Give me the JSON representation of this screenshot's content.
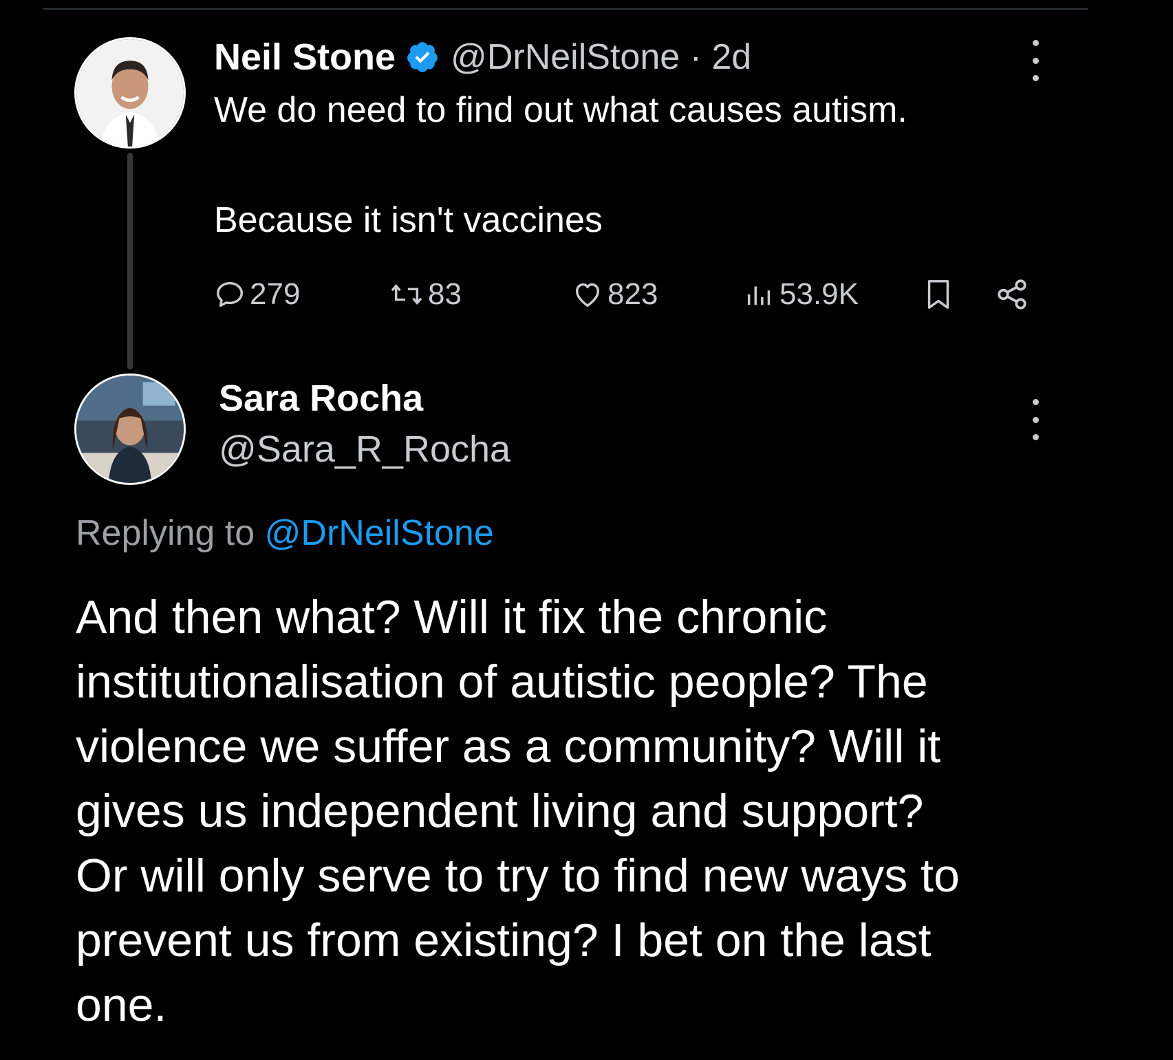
{
  "colors": {
    "background": "#000000",
    "text_primary": "#ffffff",
    "text_secondary": "#c8cbcf",
    "link": "#1d9bf0",
    "verified": "#1d9bf0",
    "divider": "#2f3336"
  },
  "original_tweet": {
    "author_name": "Neil Stone",
    "verified": true,
    "handle_time": "@DrNeilStone · 2d",
    "text_line1": "We do need to find out what causes autism.",
    "text_line2": "Because it isn't vaccines",
    "actions": {
      "replies": "279",
      "retweets": "83",
      "likes": "823",
      "views": "53.9K"
    },
    "icons": [
      "verified-icon",
      "more-icon",
      "reply-icon",
      "retweet-icon",
      "like-icon",
      "views-icon",
      "bookmark-icon",
      "share-icon"
    ]
  },
  "reply_tweet": {
    "author_name": "Sara Rocha",
    "handle": "@Sara_R_Rocha",
    "replying_prefix": "Replying to",
    "replying_mention": "@DrNeilStone",
    "body_lines": [
      "And then what? Will it fix the chronic",
      "institutionalisation of autistic people? The",
      "violence we suffer as a community? Will it",
      "gives us independent living and support?",
      "Or will only serve to try to find new ways to",
      "prevent us from existing? I bet on the last",
      "one."
    ]
  }
}
